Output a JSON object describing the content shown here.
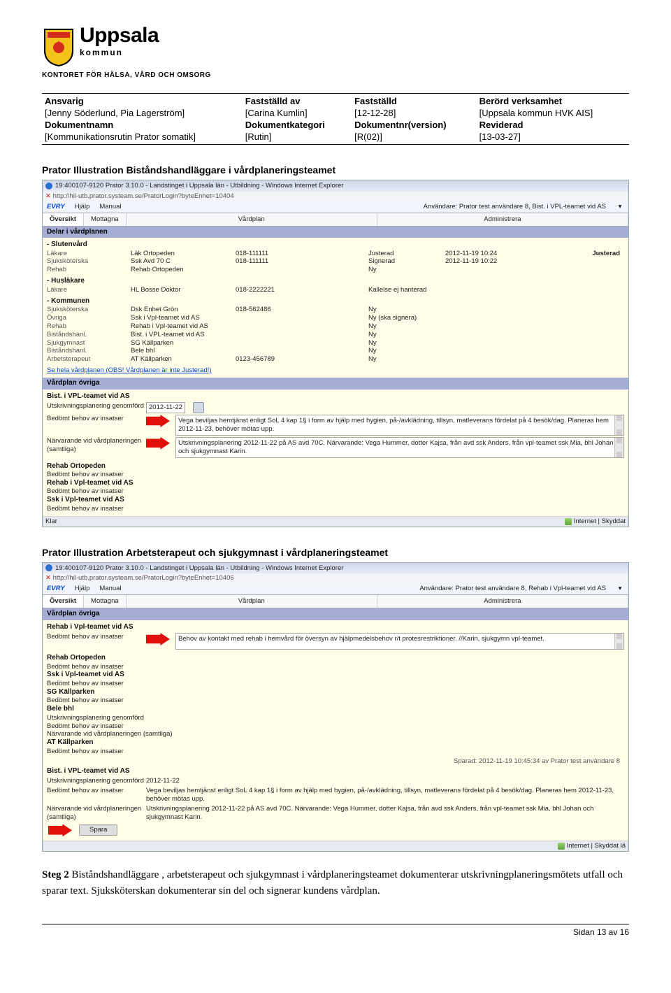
{
  "brand": {
    "name": "Uppsala",
    "sub": "kommun",
    "dept": "KONTORET FÖR HÄLSA, VÅRD OCH OMSORG"
  },
  "meta": {
    "ansvarig_hdr": "Ansvarig",
    "faststalld_av_hdr": "Fastställd av",
    "faststalld_hdr": "Fastställd",
    "berord_hdr": "Berörd verksamhet",
    "ansvarig": "[Jenny Söderlund, Pia Lagerström]",
    "faststalld_av": "[Carina Kumlin]",
    "faststalld": "[12-12-28]",
    "berord": "[Uppsala kommun HVK AIS]",
    "doknamn_hdr": "Dokumentnamn",
    "dok_kat_hdr": "Dokumentkategori",
    "dok_nr_hdr": "Dokumentnr(version)",
    "rev_hdr": "Reviderad",
    "doknamn": "[Kommunikationsrutin Prator somatik]",
    "dok_kat": "[Rutin]",
    "dok_nr": "[R(02)]",
    "rev": "[13-03-27]"
  },
  "section1": {
    "title": "Prator Illustration Biståndshandläggare i vårdplaneringsteamet",
    "ie_title": "19:400107-9120  Prator 3.10.0 - Landstinget i Uppsala län - Utbildning - Windows Internet Explorer",
    "addr": "http://hil-utb.prator.systeam.se/PratorLogin?byteEnhet=10404",
    "evry_logo": "EVRY",
    "evry_help": "Hjälp",
    "evry_manual": "Manual",
    "evry_user": "Användare: Prator test användare 8,  Bist. i VPL-teamet vid AS",
    "tabs": {
      "oversikt": "Översikt",
      "mottagna": "Mottagna",
      "vardplan": "Vårdplan",
      "admin": "Administrera"
    },
    "darktab": "Delar i vårdplanen",
    "groups": {
      "sluten": "- Slutenvård",
      "hus": "- Husläkare",
      "kom": "- Kommunen"
    },
    "rows": [
      {
        "c1": "Läkare",
        "c2": "Läk Ortopeden",
        "c3": "018-111111",
        "c4": "Justerad",
        "c5": "2012-11-19 10:24"
      },
      {
        "c1": "Sjuksköterska",
        "c2": "Ssk Avd 70 C",
        "c3": "018-111111",
        "c4": "Signerad",
        "c5": "2012-11-19 10:22"
      },
      {
        "c1": "Rehab",
        "c2": "Rehab Ortopeden",
        "c3": "",
        "c4": "Ny",
        "c5": ""
      }
    ],
    "row_hus": {
      "c1": "Läkare",
      "c2": "HL Bosse Doktor",
      "c3": "018-2222221",
      "c4": "Kallelse ej hanterad",
      "c5": ""
    },
    "rows_kom": [
      {
        "c1": "Sjuksköterska",
        "c2": "Dsk Enhet Grön",
        "c3": "018-562486",
        "c4": "Ny",
        "c5": ""
      },
      {
        "c1": "Övriga",
        "c2": "Ssk i Vpl-teamet vid AS",
        "c3": "",
        "c4": "Ny (ska signera)",
        "c5": ""
      },
      {
        "c1": "Rehab",
        "c2": "Rehab i Vpl-teamet vid AS",
        "c3": "",
        "c4": "Ny",
        "c5": ""
      },
      {
        "c1": "Biståndshanl.",
        "c2": "Bist. i VPL-teamet vid AS",
        "c3": "",
        "c4": "Ny",
        "c5": ""
      },
      {
        "c1": "Sjukgymnast",
        "c2": "SG Källparken",
        "c3": "",
        "c4": "Ny",
        "c5": ""
      },
      {
        "c1": "Biståndshanl.",
        "c2": "Bele bhl",
        "c3": "",
        "c4": "Ny",
        "c5": ""
      },
      {
        "c1": "Arbetsterapeut",
        "c2": "AT Källparken",
        "c3": "0123-456789",
        "c4": "Ny",
        "c5": ""
      }
    ],
    "se_hela": "Se hela vårdplanen (OBS! Vårdplanen är inte Justerad!)",
    "ovriga_hdr": "Vårdplan övriga",
    "group_bist": "Bist. i VPL-teamet vid AS",
    "lbl_utskr_gen": "Utskrivningsplanering genomförd",
    "date": "2012-11-22",
    "lbl_bedomt": "Bedömt behov av insatser",
    "ta_bedomt": "Vega beviljas hemtjänst enligt SoL 4 kap 1§ i form av hjälp med hygien, på-/avklädning, tillsyn, matleverans fördelat på 4 besök/dag. Planeras hem 2012-11-23, behöver mötas upp.",
    "lbl_narv": "Närvarande vid vårdplaneringen (samtliga)",
    "ta_narv": "Utskrivningsplanering 2012-11-22 på AS avd 70C. Närvarande: Vega Hummer, dotter Kajsa, från avd ssk Anders, från vpl-teamet ssk Mia, bhl Johan och sjukgymnast Karin.",
    "group_rehab_ort": "Rehab Ortopeden",
    "group_rehab_vpl": "Rehab i Vpl-teamet vid AS",
    "group_ssk_vpl": "Ssk i Vpl-teamet vid AS",
    "klar": "Klar",
    "footer_zone": "Internet | Skyddat"
  },
  "section2": {
    "title": "Prator Illustration Arbetsterapeut och sjukgymnast i vårdplaneringsteamet",
    "ie_title": "19:400107-9120  Prator 3.10.0 - Landstinget i Uppsala län - Utbildning - Windows Internet Explorer",
    "addr": "http://hil-utb.prator.systeam.se/PratorLogin?byteEnhet=10406",
    "evry_user": "Användare: Prator test användare 8,  Rehab i Vpl-teamet vid AS",
    "ovriga_hdr": "Vårdplan övriga",
    "group1": "Rehab i Vpl-teamet vid AS",
    "ta_behov": "Behov av kontakt med rehab i hemvård för översyn av hjälpmedelsbehov r/t protesrestriktioner. //Karin, sjukgymn vpl-teamet.",
    "group2": "Rehab Ortopeden",
    "group3": "Ssk i Vpl-teamet vid AS",
    "group4": "SG Källparken",
    "group5": "Bele bhl",
    "group5b_lbl1": "Utskrivningsplanering genomförd",
    "group5b_lbl2": "Bedömt behov av insatser",
    "group5b_lbl3": "Närvarande vid vårdplaneringen (samtliga)",
    "group6": "AT Källparken",
    "group7": "Bist. i VPL-teamet vid AS",
    "saved": "Sparad: 2012-11-19 10:45:34 av Prator test användare 8",
    "date": "2012-11-22",
    "ta_vega": "Vega beviljas hemtjänst enligt SoL 4 kap 1§ i form av hjälp med hygien, på-/avklädning, tillsyn, matleverans fördelat på 4 besök/dag. Planeras hem 2012-11-23, behöver mötas upp.",
    "ta_narv": "Utskrivningsplanering 2012-11-22 på AS avd 70C. Närvarande: Vega Hummer, dotter Kajsa, från avd ssk Anders, från vpl-teamet ssk Mia, bhl Johan och sjukgymnast Karin.",
    "save_btn": "Spara",
    "footer_zone": "Internet | Skyddat lä"
  },
  "body": "Steg 2 Biståndshandläggare , arbetsterapeut och sjukgymnast i vårdplaneringsteamet dokumenterar utskrivningplaneringsmötets utfall och sparar text. Sjuksköterskan dokumenterar sin del och signerar kundens vårdplan.",
  "pagenum": "Sidan 13 av 16"
}
